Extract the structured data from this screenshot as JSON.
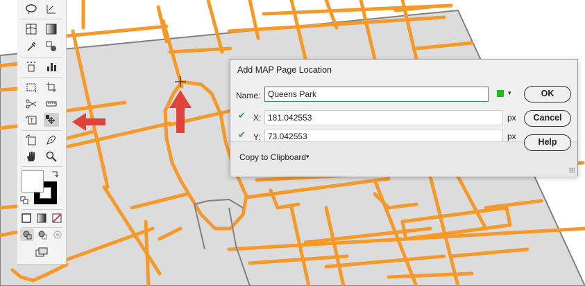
{
  "map": {
    "colors": {
      "background": "#ffffff",
      "block": "#dcdcdc",
      "road": "#f5992a",
      "boundary": "#808080",
      "arrow": "#e0433a"
    }
  },
  "toolbar": {
    "tools": [
      "lasso-tool-icon",
      "graph-tool-icon",
      "mesh-tool-icon",
      "gradient-tool-icon",
      "eyedropper-tool-icon",
      "blend-tool-icon",
      "symbol-sprayer-tool-icon",
      "column-graph-tool-icon",
      "artboard-tool-icon",
      "slice-tool-icon",
      "scissors-tool-icon",
      "measure-tool-icon",
      "area-type-tool-icon",
      "map-page-location-tool-icon",
      "rotate-view-tool-icon",
      "pen-tool-icon",
      "hand-tool-icon",
      "zoom-tool-icon"
    ],
    "fill_color": "#ffffff",
    "stroke_color": "#000000"
  },
  "dialog": {
    "title": "Add MAP Page Location",
    "name_label": "Name:",
    "name_value": "Queens Park",
    "marker_color": "#22bb22",
    "x_label": "X:",
    "x_value": "181.042553",
    "y_label": "Y:",
    "y_value": "73.042553",
    "unit": "px",
    "copy_label": "Copy to Clipboard",
    "ok_label": "OK",
    "cancel_label": "Cancel",
    "help_label": "Help"
  }
}
